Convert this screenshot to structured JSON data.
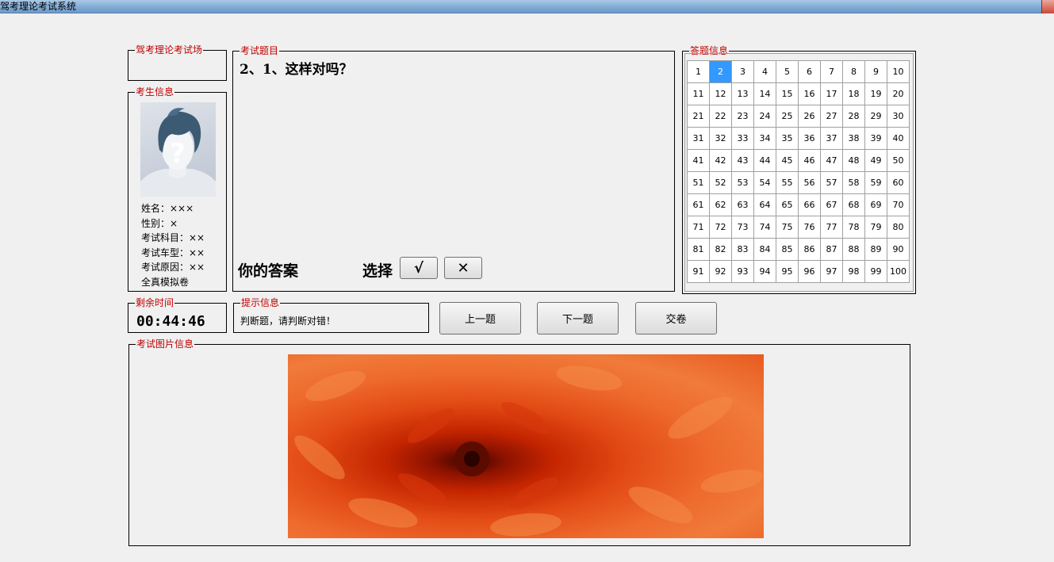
{
  "window": {
    "title": "驾考理论考试系统"
  },
  "exam_hall": {
    "legend": "驾考理论考试场"
  },
  "candidate": {
    "legend": "考生信息",
    "name_line": "姓名：×××",
    "gender_line": "性别：×",
    "subject_line": "考试科目：××",
    "vehicle_line": "考试车型：××",
    "reason_line": "考试原因：××",
    "mode_line": "全真模拟卷"
  },
  "question": {
    "legend": "考试题目",
    "text": "2、1、这样对吗？",
    "answer_label": "你的答案",
    "choose_label": "选择",
    "true_label": "√",
    "false_label": "✕"
  },
  "answer_grid": {
    "legend": "答题信息",
    "current": 2,
    "total": 100,
    "columns": 10
  },
  "timer": {
    "legend": "剩余时间",
    "value": "00:44:46"
  },
  "hint": {
    "legend": "提示信息",
    "text": "判断题，请判断对错！"
  },
  "nav": {
    "prev_label": "上一题",
    "next_label": "下一题",
    "submit_label": "交卷"
  },
  "picture": {
    "legend": "考试图片信息"
  },
  "colors": {
    "legend_text": "#c00000",
    "current_cell": "#3399ff",
    "background": "#f0f0f0"
  }
}
